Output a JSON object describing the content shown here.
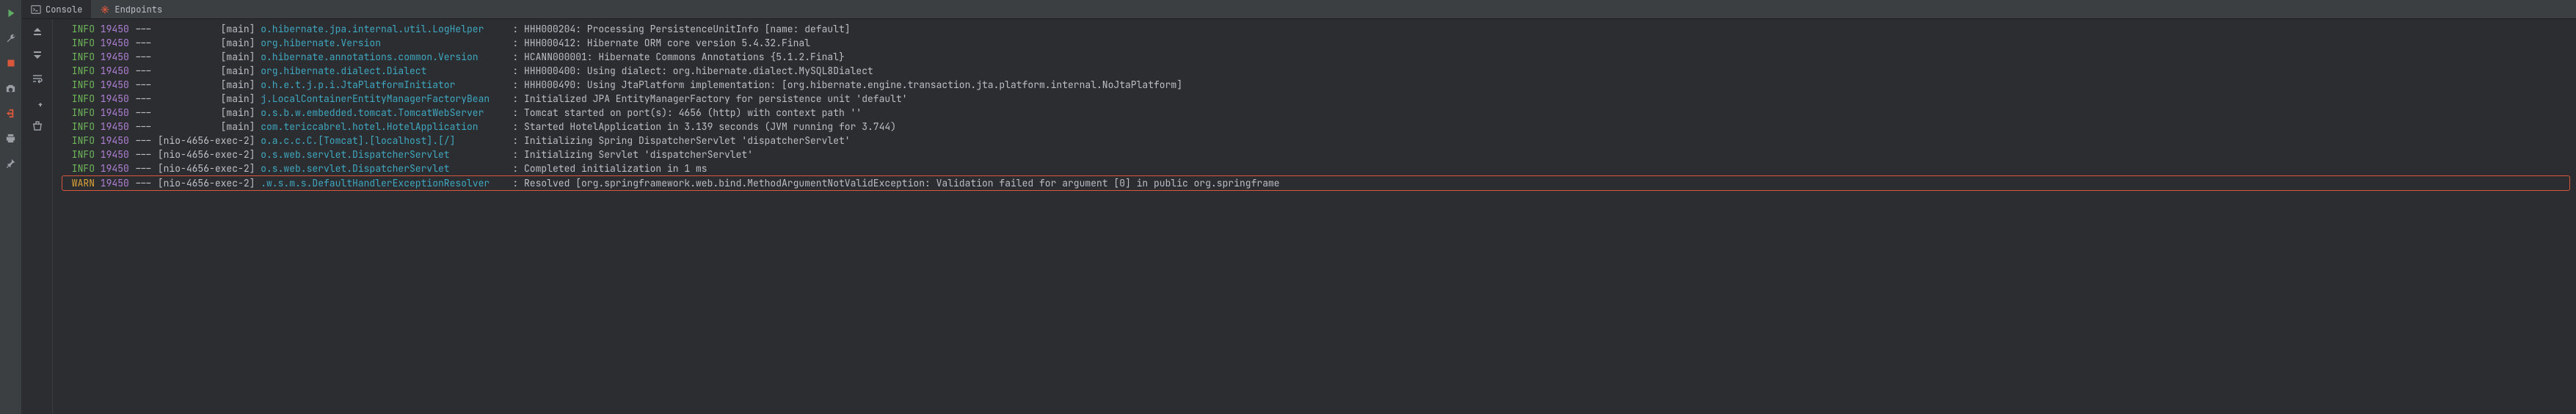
{
  "tabs": {
    "console": {
      "label": "Console"
    },
    "endpoints": {
      "label": "Endpoints"
    }
  },
  "log": {
    "pidCol": "19450",
    "sepCol": "---",
    "lines": [
      {
        "level": "INFO",
        "thread": "main",
        "logger": "o.hibernate.jpa.internal.util.LogHelper",
        "msg": "HHH000204: Processing PersistenceUnitInfo [name: default]",
        "cutoff": true
      },
      {
        "level": "INFO",
        "thread": "main",
        "logger": "org.hibernate.Version",
        "msg": "HHH000412: Hibernate ORM core version 5.4.32.Final"
      },
      {
        "level": "INFO",
        "thread": "main",
        "logger": "o.hibernate.annotations.common.Version",
        "msg": "HCANN000001: Hibernate Commons Annotations {5.1.2.Final}"
      },
      {
        "level": "INFO",
        "thread": "main",
        "logger": "org.hibernate.dialect.Dialect",
        "msg": "HHH000400: Using dialect: org.hibernate.dialect.MySQL8Dialect"
      },
      {
        "level": "INFO",
        "thread": "main",
        "logger": "o.h.e.t.j.p.i.JtaPlatformInitiator",
        "msg": "HHH000490: Using JtaPlatform implementation: [org.hibernate.engine.transaction.jta.platform.internal.NoJtaPlatform]"
      },
      {
        "level": "INFO",
        "thread": "main",
        "logger": "j.LocalContainerEntityManagerFactoryBean",
        "msg": "Initialized JPA EntityManagerFactory for persistence unit 'default'"
      },
      {
        "level": "INFO",
        "thread": "main",
        "logger": "o.s.b.w.embedded.tomcat.TomcatWebServer",
        "msg": "Tomcat started on port(s): 4656 (http) with context path ''"
      },
      {
        "level": "INFO",
        "thread": "main",
        "logger": "com.tericcabrel.hotel.HotelApplication",
        "msg": "Started HotelApplication in 3.139 seconds (JVM running for 3.744)"
      },
      {
        "level": "INFO",
        "thread": "nio-4656-exec-2",
        "logger": "o.a.c.c.C.[Tomcat].[localhost].[/]",
        "msg": "Initializing Spring DispatcherServlet 'dispatcherServlet'"
      },
      {
        "level": "INFO",
        "thread": "nio-4656-exec-2",
        "logger": "o.s.web.servlet.DispatcherServlet",
        "msg": "Initializing Servlet 'dispatcherServlet'"
      },
      {
        "level": "INFO",
        "thread": "nio-4656-exec-2",
        "logger": "o.s.web.servlet.DispatcherServlet",
        "msg": "Completed initialization in 1 ms"
      },
      {
        "level": "WARN",
        "thread": "nio-4656-exec-2",
        "logger": ".w.s.m.s.DefaultHandlerExceptionResolver",
        "msg": "Resolved [org.springframework.web.bind.MethodArgumentNotValidException: Validation failed for argument [0] in public org.springframe",
        "highlight": true
      }
    ]
  }
}
